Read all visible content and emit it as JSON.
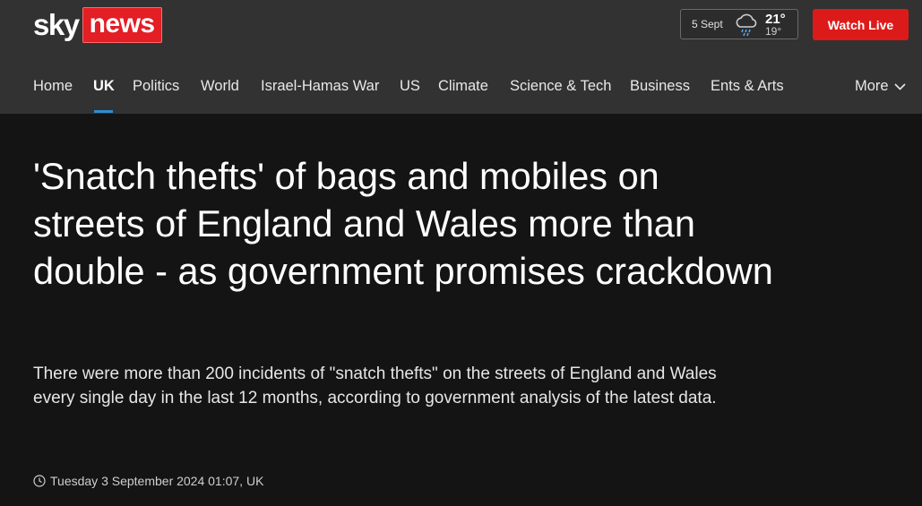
{
  "brand": {
    "sky": "sky",
    "news": "news",
    "news_bg": "#e31e24"
  },
  "weather": {
    "date": "5 Sept",
    "icon": "rain-cloud-icon",
    "high": "21°",
    "low": "19°"
  },
  "watch_live": {
    "label": "Watch Live",
    "color": "#dd1a1a"
  },
  "nav": {
    "items": [
      {
        "label": "Home"
      },
      {
        "label": "UK",
        "active": true
      },
      {
        "label": "Politics"
      },
      {
        "label": "World"
      },
      {
        "label": "Israel-Hamas War"
      },
      {
        "label": "US"
      },
      {
        "label": "Climate"
      },
      {
        "label": "Science & Tech"
      },
      {
        "label": "Business"
      },
      {
        "label": "Ents & Arts"
      }
    ],
    "more": "More",
    "active_color": "#2f8bd1"
  },
  "article": {
    "headline": "'Snatch thefts' of bags and mobiles on streets of England and Wales more than double - as government promises crackdown",
    "standfirst": "There were more than 200 incidents of \"snatch thefts\" on the streets of England and Wales every single day in the last 12 months, according to government analysis of the latest data.",
    "timestamp": "Tuesday 3 September 2024 01:07, UK"
  }
}
